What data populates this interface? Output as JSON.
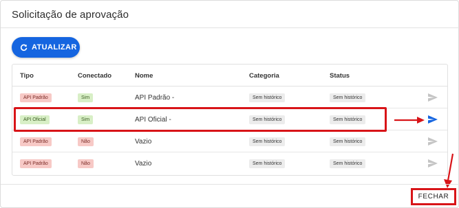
{
  "dialog": {
    "title": "Solicitação de aprovação",
    "refresh_label": "ATUALIZAR",
    "close_label": "FECHAR"
  },
  "table": {
    "headers": [
      "Tipo",
      "Conectado",
      "Nome",
      "Categoria",
      "Status"
    ],
    "rows": [
      {
        "tipo": "API Padrão",
        "conectado": "Sim",
        "nome": "API Padrão -",
        "categoria": "Sem histórico",
        "status": "Sem histórico",
        "send_active": false
      },
      {
        "tipo": "API Oficial",
        "conectado": "Sim",
        "nome": "API Oficial -",
        "categoria": "Sem histórico",
        "status": "Sem histórico",
        "send_active": true
      },
      {
        "tipo": "API Padrão",
        "conectado": "Não",
        "nome": "Vazio",
        "categoria": "Sem histórico",
        "status": "Sem histórico",
        "send_active": false
      },
      {
        "tipo": "API Padrão",
        "conectado": "Não",
        "nome": "Vazio",
        "categoria": "Sem histórico",
        "status": "Sem histórico",
        "send_active": false
      }
    ]
  },
  "colors": {
    "primary": "#1565e0",
    "annotation_red": "#d81418",
    "badge_red_bg": "#f7c9c6",
    "badge_green_bg": "#d8efc6",
    "send_inactive": "#c4c4c4"
  },
  "icons": {
    "refresh": "refresh-icon",
    "send": "send-icon"
  }
}
